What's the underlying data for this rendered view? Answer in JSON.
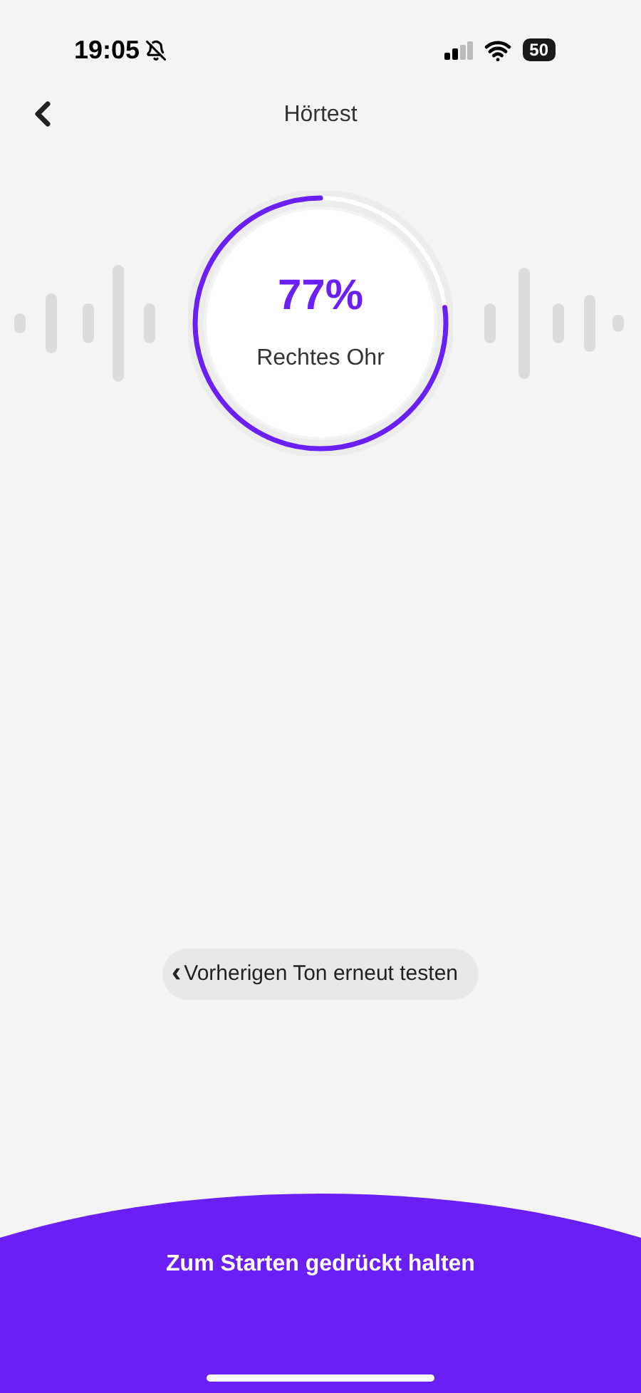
{
  "status_bar": {
    "time": "19:05",
    "battery": "50"
  },
  "nav": {
    "title": "Hörtest"
  },
  "progress": {
    "percent": "77%",
    "level": 0.77,
    "label": "Rechtes Ohr"
  },
  "retry_button": {
    "icon": "‹",
    "label": "Vorherigen Ton erneut testen"
  },
  "start_panel": {
    "label": "Zum Starten gedrückt halten"
  }
}
